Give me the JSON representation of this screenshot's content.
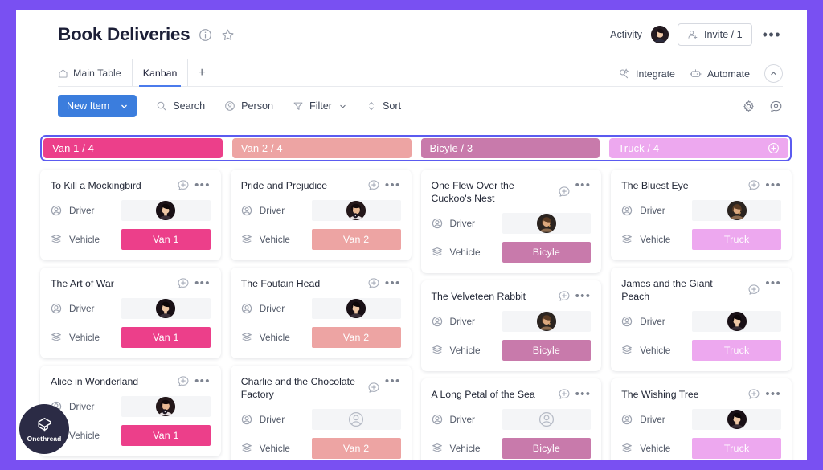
{
  "header": {
    "title": "Book Deliveries",
    "info_icon": "info-circle-icon",
    "star_icon": "star-icon",
    "activity_label": "Activity",
    "invite_label": "Invite / 1",
    "more_label": "•••"
  },
  "tabs": {
    "items": [
      {
        "label": "Main Table",
        "icon": "home-icon",
        "active": false
      },
      {
        "label": "Kanban",
        "icon": "",
        "active": true
      }
    ],
    "add_label": "+",
    "right_items": [
      {
        "label": "Integrate",
        "icon": "integrate-icon"
      },
      {
        "label": "Automate",
        "icon": "automate-robot-icon"
      }
    ],
    "collapse_icon": "chevron-up-icon"
  },
  "toolbar": {
    "new_item_label": "New Item",
    "items": [
      {
        "label": "Search",
        "icon": "search-icon",
        "caret": false
      },
      {
        "label": "Person",
        "icon": "person-icon",
        "caret": false
      },
      {
        "label": "Filter",
        "icon": "filter-icon",
        "caret": true
      },
      {
        "label": "Sort",
        "icon": "sort-icon",
        "caret": false
      }
    ],
    "right_icons": [
      "gear-icon",
      "chat-heart-icon"
    ]
  },
  "board": {
    "selection_color": "#5b5bf0",
    "columns": [
      {
        "id": "van-1",
        "header": "Van 1 / 4",
        "color": "#ec3f8a",
        "chip_color": "#ec3f8a",
        "show_add": false,
        "cards": [
          {
            "title": "To Kill a Mockingbird",
            "driver_label": "Driver",
            "vehicle_label": "Vehicle",
            "vehicle": "Van 1",
            "driver": "avatar-dark-hair",
            "has_driver": true
          },
          {
            "title": "The Art of War",
            "driver_label": "Driver",
            "vehicle_label": "Vehicle",
            "vehicle": "Van 1",
            "driver": "avatar-dark-hair",
            "has_driver": true
          },
          {
            "title": "Alice in Wonderland",
            "driver_label": "Driver",
            "vehicle_label": "Vehicle",
            "vehicle": "Van 1",
            "driver": "avatar-curly-hair",
            "has_driver": true
          }
        ]
      },
      {
        "id": "van-2",
        "header": "Van 2 / 4",
        "color": "#eda4a3",
        "chip_color": "#eda4a3",
        "show_add": false,
        "cards": [
          {
            "title": "Pride and Prejudice",
            "driver_label": "Driver",
            "vehicle_label": "Vehicle",
            "vehicle": "Van 2",
            "driver": "avatar-curly-hair",
            "has_driver": true
          },
          {
            "title": "The Foutain Head",
            "driver_label": "Driver",
            "vehicle_label": "Vehicle",
            "vehicle": "Van 2",
            "driver": "avatar-dark-hair",
            "has_driver": true
          },
          {
            "title": "Charlie and the Chocolate Factory",
            "driver_label": "Driver",
            "vehicle_label": "Vehicle",
            "vehicle": "Van 2",
            "driver": "",
            "has_driver": false
          }
        ]
      },
      {
        "id": "bicyle",
        "header": "Bicyle / 3",
        "color": "#c87aab",
        "chip_color": "#c87aab",
        "show_add": false,
        "cards": [
          {
            "title": "One Flew Over the Cuckoo's Nest",
            "driver_label": "Driver",
            "vehicle_label": "Vehicle",
            "vehicle": "Bicyle",
            "driver": "avatar-brown-hair",
            "has_driver": true
          },
          {
            "title": "The Velveteen Rabbit",
            "driver_label": "Driver",
            "vehicle_label": "Vehicle",
            "vehicle": "Bicyle",
            "driver": "avatar-brown-hair",
            "has_driver": true
          },
          {
            "title": "A Long Petal of the Sea",
            "driver_label": "Driver",
            "vehicle_label": "Vehicle",
            "vehicle": "Bicyle",
            "driver": "",
            "has_driver": false
          }
        ]
      },
      {
        "id": "truck",
        "header": "Truck / 4",
        "color": "#eda8ef",
        "chip_color": "#eda8ef",
        "show_add": true,
        "add_icon": "plus-circle-icon",
        "cards": [
          {
            "title": "The Bluest Eye",
            "driver_label": "Driver",
            "vehicle_label": "Vehicle",
            "vehicle": "Truck",
            "driver": "avatar-brown-hair",
            "has_driver": true
          },
          {
            "title": "James and the Giant Peach",
            "driver_label": "Driver",
            "vehicle_label": "Vehicle",
            "vehicle": "Truck",
            "driver": "avatar-dark-hair",
            "has_driver": true
          },
          {
            "title": "The Wishing Tree",
            "driver_label": "Driver",
            "vehicle_label": "Vehicle",
            "vehicle": "Truck",
            "driver": "avatar-dark-hair",
            "has_driver": true
          }
        ]
      }
    ]
  },
  "watermark": {
    "label": "Onethread",
    "icon": "cube-logo-icon"
  }
}
